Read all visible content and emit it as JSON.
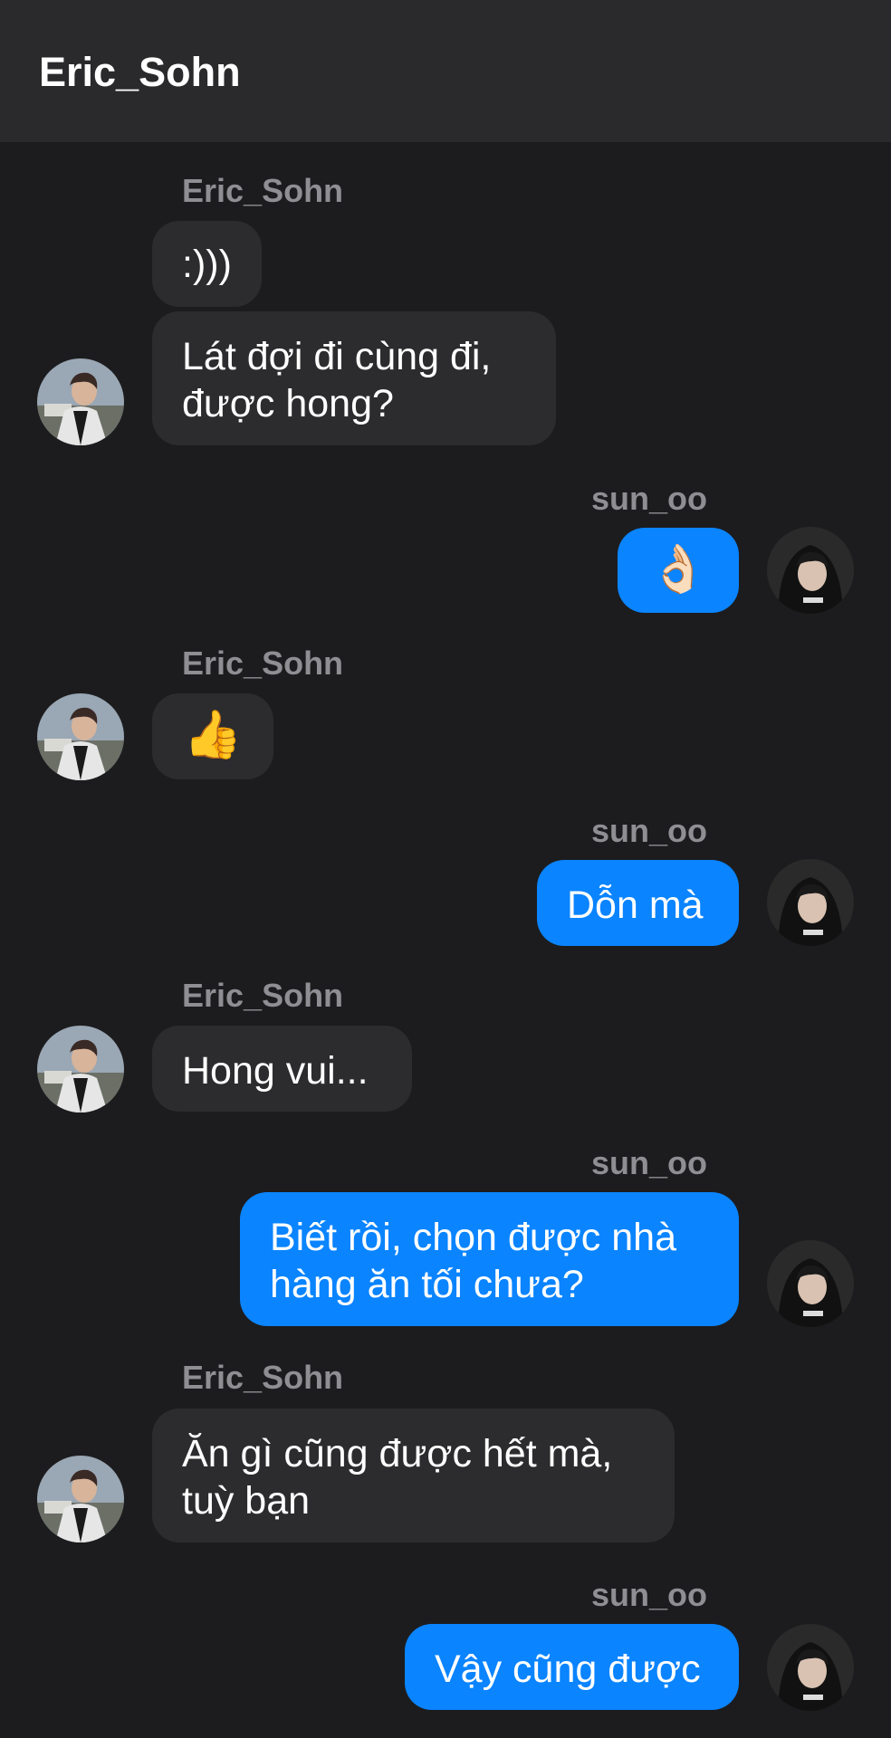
{
  "header": {
    "title": "Eric_Sohn"
  },
  "messages": [
    {
      "sender": "Eric_Sohn",
      "text": ":)))"
    },
    {
      "sender": "Eric_Sohn",
      "text": "Lát đợi đi cùng đi,\nđược hong?"
    },
    {
      "sender": "sun_oo",
      "text": "👌🏻"
    },
    {
      "sender": "Eric_Sohn",
      "text": "👍"
    },
    {
      "sender": "sun_oo",
      "text": "Dỗn mà"
    },
    {
      "sender": "Eric_Sohn",
      "text": "Hong vui..."
    },
    {
      "sender": "sun_oo",
      "text": "Biết rồi, chọn được nhà\nhàng ăn tối chưa?"
    },
    {
      "sender": "Eric_Sohn",
      "text": "Ăn gì cũng được hết mà,\ntuỳ bạn"
    },
    {
      "sender": "sun_oo",
      "text": "Vậy cũng được"
    }
  ],
  "colors": {
    "background": "#1c1c1e",
    "header": "#2a2a2c",
    "incoming_bubble": "#2c2c2e",
    "outgoing_bubble": "#0a84ff",
    "name_text": "#8e8e93"
  }
}
